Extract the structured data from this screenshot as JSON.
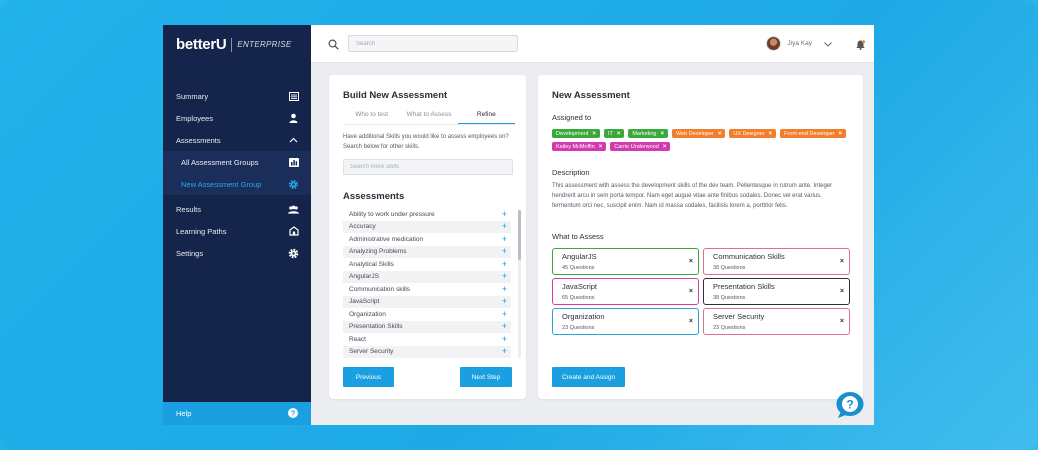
{
  "sidebar": {
    "brand": "betterU",
    "edition": "ENTERPRISE",
    "items": [
      {
        "label": "Summary",
        "icon": "list-icon"
      },
      {
        "label": "Employees",
        "icon": "person-icon"
      },
      {
        "label": "Assessments",
        "icon": "chevron-up-icon"
      },
      {
        "label": "All Assessment Groups",
        "icon": "chart-icon"
      },
      {
        "label": "New Assessment Group",
        "icon": "gear-icon"
      },
      {
        "label": "Results",
        "icon": "group-icon"
      },
      {
        "label": "Learning Paths",
        "icon": "path-icon"
      },
      {
        "label": "Settings",
        "icon": "settings-icon"
      }
    ],
    "help": "Help"
  },
  "topbar": {
    "search_placeholder": "Search",
    "user_name": "Jiya Kay"
  },
  "build": {
    "title": "Build New Assessment",
    "tabs": [
      "Who to test",
      "What to Assess",
      "Refine"
    ],
    "active_tab": "Refine",
    "hint": "Have additional Skills you would like to assess employees on? Search below for other skills.",
    "search_placeholder": "Search more skills",
    "assessments_title": "Assessments",
    "skills": [
      "Ability to work under pressure",
      "Accuracy",
      "Administrative medication",
      "Analyzing Problems",
      "Analytical Skills",
      "AngularJS",
      "Communication skills",
      "JavaScript",
      "Organization",
      "Presentation Skills",
      "React",
      "Server Security"
    ],
    "prev_label": "Previous",
    "next_label": "Next Step"
  },
  "new_assessment": {
    "title": "New Assessment",
    "assigned_label": "Assigned to",
    "tags": [
      {
        "label": "Development",
        "color": "#3aa83a"
      },
      {
        "label": "IT",
        "color": "#3aa83a"
      },
      {
        "label": "Marketing",
        "color": "#3aa83a"
      },
      {
        "label": "Web Developer",
        "color": "#f07e2a"
      },
      {
        "label": "UX Designer",
        "color": "#f07e2a"
      },
      {
        "label": "Front-end Developer",
        "color": "#f07e2a"
      },
      {
        "label": "Kailey McMoffin",
        "color": "#d43ab0"
      },
      {
        "label": "Carrie Underwood",
        "color": "#d43ab0"
      }
    ],
    "description_label": "Description",
    "description": "This assessment with assess the development skills of the dev team.  Pellentesque in rutrum ante. Integer hendrerit arcu in sem porta tempor. Nam eget augue vitae ante finibus sodales. Donec vel erat varius, fermentum orci nec, suscipit enim. Nam id massa sodales, facilisis lorem a, porttitor felis.",
    "what_label": "What to Assess",
    "items": [
      {
        "name": "AngularJS",
        "count": "45 Questions",
        "color": "#3aa83a"
      },
      {
        "name": "Communication Skills",
        "count": "38 Questions",
        "color": "#e0708a"
      },
      {
        "name": "JavaScript",
        "count": "65 Questions",
        "color": "#d43ab0"
      },
      {
        "name": "Presentation Skills",
        "count": "38 Questions",
        "color": "#2a2f3a"
      },
      {
        "name": "Organization",
        "count": "23 Questions",
        "color": "#2aa4d6"
      },
      {
        "name": "Server Security",
        "count": "23 Questions",
        "color": "#e0708a"
      }
    ],
    "create_label": "Create and Assign"
  },
  "colors": {
    "accent": "#1a9fe0",
    "sidebar": "#14244a"
  }
}
